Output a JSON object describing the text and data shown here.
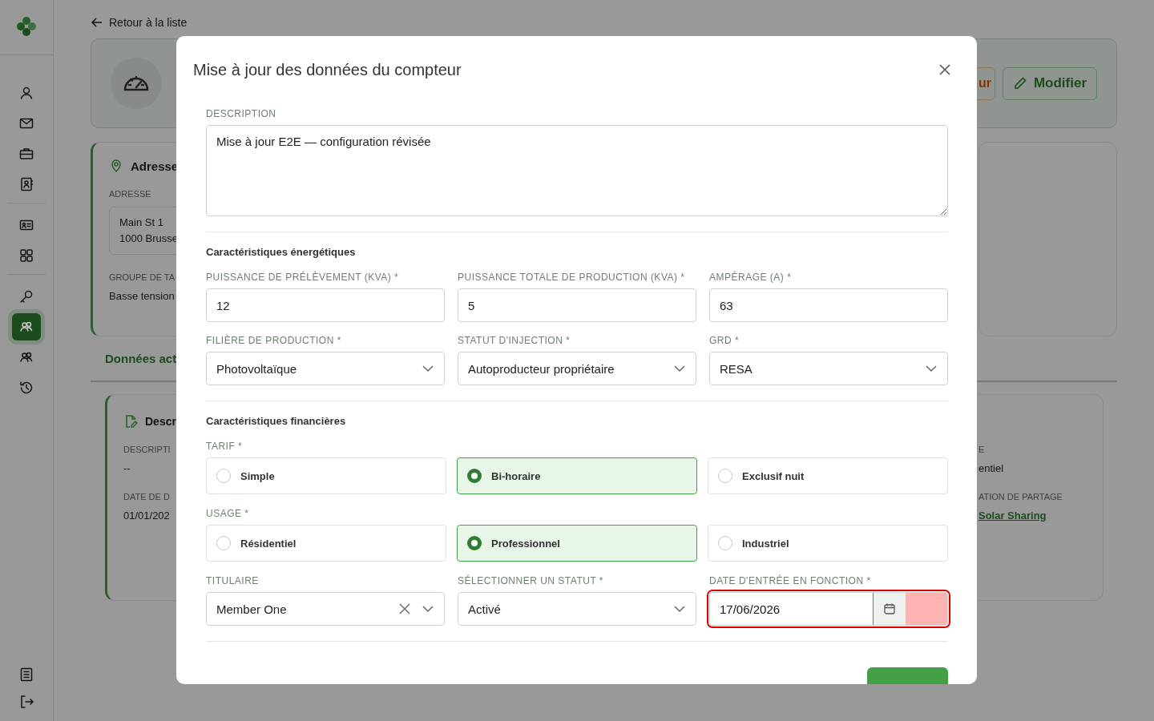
{
  "sidebar": {
    "items": [
      {
        "selected": false
      },
      {
        "selected": false
      },
      {
        "selected": false
      },
      {
        "selected": false
      },
      {
        "selected": false
      },
      {
        "selected": false
      },
      {
        "selected": false
      },
      {
        "selected": true
      },
      {
        "selected": false
      },
      {
        "selected": false
      }
    ]
  },
  "page": {
    "back_link": "Retour à la liste",
    "header": {
      "buttons": [
        {
          "label": "ur",
          "kind": "warning"
        },
        {
          "label": "Modifier",
          "kind": "primary"
        }
      ]
    },
    "address_card": {
      "title": "Adresse",
      "fields": [
        {
          "label": "ADRESSE",
          "lines": [
            "Main St 1",
            "1000 Brusse"
          ]
        },
        {
          "label": "GROUPE DE TA",
          "value": "Basse tension"
        }
      ]
    },
    "tabs": [
      {
        "label": "Données act",
        "selected": true
      }
    ],
    "detail_card": {
      "title": "Descr",
      "left_fields": [
        {
          "label": "DESCRIPTI",
          "value": "--"
        },
        {
          "label": "DATE DE D",
          "value": "01/01/202"
        }
      ],
      "right_fields": [
        {
          "label": "E",
          "value": "entiel",
          "kind": "text"
        },
        {
          "label": "ATION DE PARTAGE",
          "value": "Solar Sharing",
          "kind": "link"
        }
      ]
    }
  },
  "modal": {
    "title": "Mise à jour des données du compteur",
    "description": {
      "label": "DESCRIPTION",
      "value": "Mise à jour E2E — configuration révisée"
    },
    "sections": [
      {
        "title": "Caractéristiques énergétiques",
        "rows": [
          [
            {
              "kind": "input",
              "label": "PUISSANCE DE PRÉLÈVEMENT (KVA) *",
              "value": "12"
            },
            {
              "kind": "input",
              "label": "PUISSANCE TOTALE DE PRODUCTION (KVA) *",
              "value": "5"
            },
            {
              "kind": "input",
              "label": "AMPÉRAGE (A) *",
              "value": "63"
            }
          ],
          [
            {
              "kind": "select",
              "label": "FILIÈRE DE PRODUCTION *",
              "value": "Photovoltaïque"
            },
            {
              "kind": "select",
              "label": "STATUT D'INJECTION *",
              "value": "Autoproducteur propriétaire"
            },
            {
              "kind": "select",
              "label": "GRD *",
              "value": "RESA"
            }
          ]
        ]
      },
      {
        "title": "Caractéristiques financières",
        "radio_groups": [
          {
            "label": "TARIF *",
            "options": [
              {
                "label": "Simple",
                "selected": false
              },
              {
                "label": "Bi-horaire",
                "selected": true
              },
              {
                "label": "Exclusif nuit",
                "selected": false
              }
            ]
          },
          {
            "label": "USAGE *",
            "options": [
              {
                "label": "Résidentiel",
                "selected": false
              },
              {
                "label": "Professionnel",
                "selected": true
              },
              {
                "label": "Industriel",
                "selected": false
              }
            ]
          }
        ],
        "rows": [
          [
            {
              "kind": "select",
              "label": "TITULAIRE",
              "value": "Member One",
              "clearable": true
            },
            {
              "kind": "select",
              "label": "SÉLECTIONNER UN STATUT *",
              "value": "Activé"
            },
            {
              "kind": "date",
              "label": "DATE D'ENTRÉE EN FONCTION *",
              "value": "17/06/2026",
              "invalid": true
            }
          ]
        ]
      }
    ],
    "footer": {
      "buttons": [
        {
          "kind": "primary"
        }
      ]
    }
  }
}
